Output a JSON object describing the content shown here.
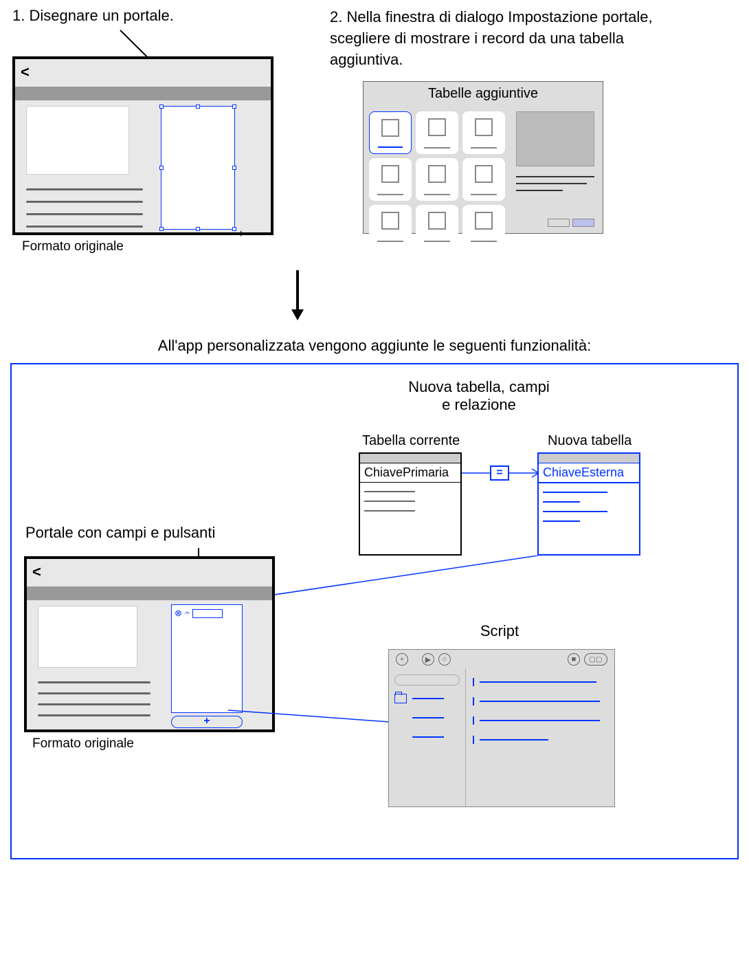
{
  "step1": "1. Disegnare un portale.",
  "step2": "2. Nella finestra di dialogo Impostazione portale, scegliere di mostrare i record da una tabella aggiuntiva.",
  "caption_original_layout": "Formato originale",
  "dialog_title": "Tabelle aggiuntive",
  "result_intro": "All'app personalizzata vengono aggiunte le seguenti funzionalità:",
  "results": {
    "new_table_title_line1": "Nuova tabella, campi",
    "new_table_title_line2": "e relazione",
    "current_table_label": "Tabella corrente",
    "new_table_label": "Nuova tabella",
    "primary_key": "ChiavePrimaria",
    "foreign_key": "ChiaveEsterna",
    "equals": "=",
    "portal_label": "Portale con campi e pulsanti",
    "script_label": "Script",
    "portal_add": "+",
    "chevron": "<"
  }
}
